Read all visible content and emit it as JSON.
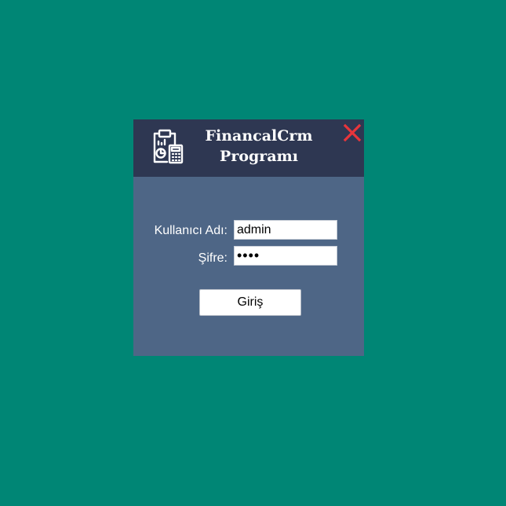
{
  "window": {
    "title": "FinancalCrm Programı",
    "icon": "clipboard-calculator-icon",
    "close_icon": "close-icon"
  },
  "form": {
    "username_label": "Kullanıcı Adı:",
    "username_value": "admin",
    "password_label": "Şifre:",
    "password_value": "••••",
    "login_button_label": "Giriş"
  },
  "colors": {
    "desktop_background": "#008675",
    "title_bar": "#2e3752",
    "panel": "#4e6686",
    "close_icon": "#e8353b"
  }
}
